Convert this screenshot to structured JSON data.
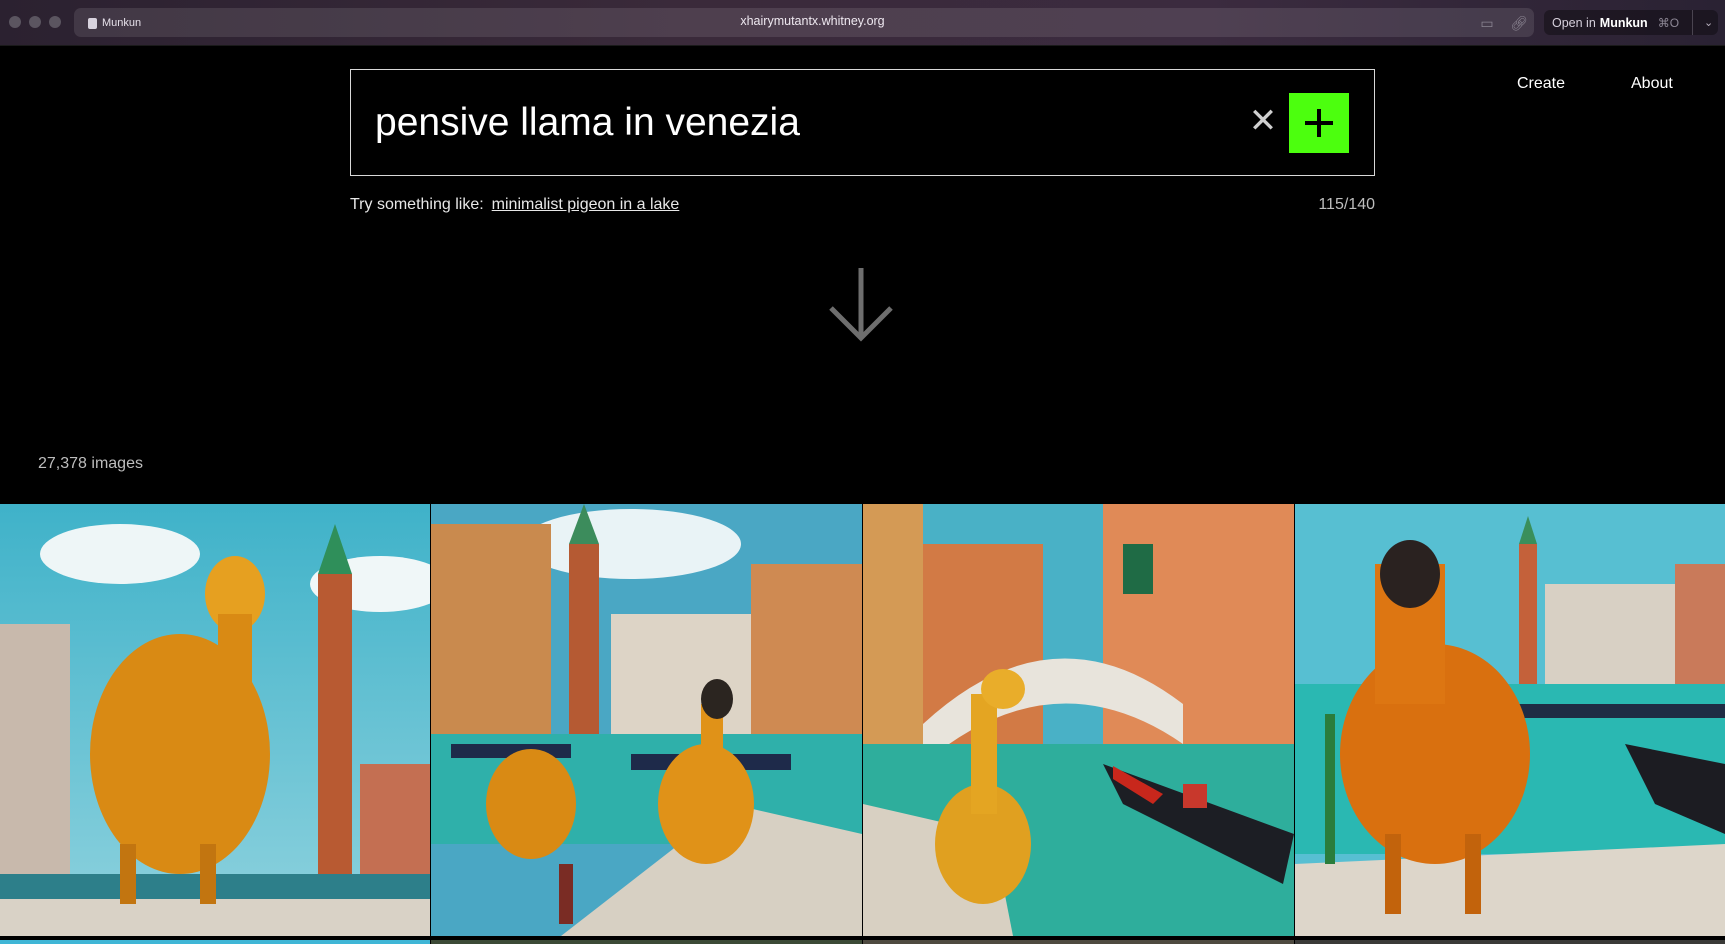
{
  "browser": {
    "tab_title": "Munkun",
    "url": "xhairymutantx.whitney.org",
    "open_in_prefix": "Open in",
    "open_in_app": "Munkun",
    "open_in_shortcut": "⌘O"
  },
  "nav": {
    "create_label": "Create",
    "about_label": "About"
  },
  "search": {
    "value": "pensive llama in venezia",
    "clear_glyph": "✕"
  },
  "suggestion": {
    "prefix": "Try something like:",
    "example": "minimalist pigeon in a lake"
  },
  "char_counter": "115/140",
  "gallery": {
    "count_label": "27,378 images"
  },
  "colors": {
    "accent_green": "#4cff0e",
    "background": "#000000"
  }
}
